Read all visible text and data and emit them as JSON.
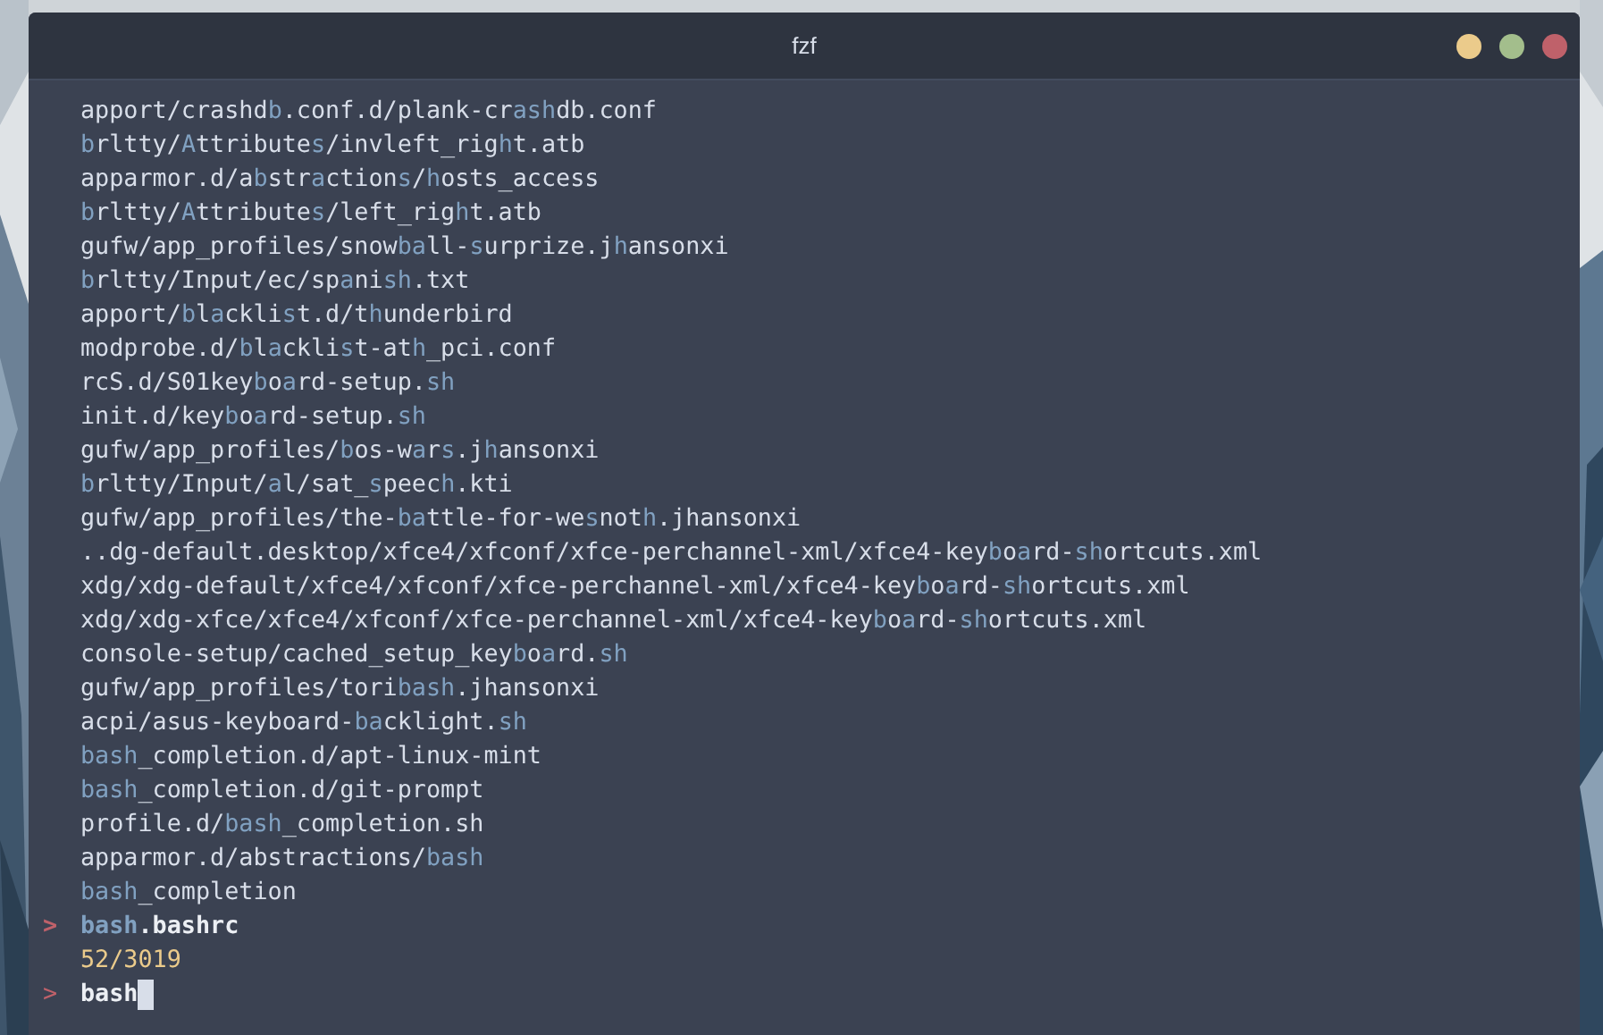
{
  "window": {
    "title": "fzf",
    "buttons": [
      {
        "color": "#ebcb8b"
      },
      {
        "color": "#a3be8c"
      },
      {
        "color": "#bf616a"
      }
    ]
  },
  "results": [
    {
      "segments": [
        {
          "text": "apport/crashd",
          "match": false
        },
        {
          "text": "b",
          "match": true
        },
        {
          "text": ".conf.d/plank-cr",
          "match": false
        },
        {
          "text": "ash",
          "match": true
        },
        {
          "text": "db.conf",
          "match": false
        }
      ]
    },
    {
      "segments": [
        {
          "text": "b",
          "match": true
        },
        {
          "text": "rltty/",
          "match": false
        },
        {
          "text": "A",
          "match": true
        },
        {
          "text": "ttribute",
          "match": false
        },
        {
          "text": "s",
          "match": true
        },
        {
          "text": "/invleft_rig",
          "match": false
        },
        {
          "text": "h",
          "match": true
        },
        {
          "text": "t.atb",
          "match": false
        }
      ]
    },
    {
      "segments": [
        {
          "text": "apparmor.d/a",
          "match": false
        },
        {
          "text": "b",
          "match": true
        },
        {
          "text": "str",
          "match": false
        },
        {
          "text": "a",
          "match": true
        },
        {
          "text": "ction",
          "match": false
        },
        {
          "text": "s",
          "match": true
        },
        {
          "text": "/",
          "match": false
        },
        {
          "text": "h",
          "match": true
        },
        {
          "text": "osts_access",
          "match": false
        }
      ]
    },
    {
      "segments": [
        {
          "text": "b",
          "match": true
        },
        {
          "text": "rltty/",
          "match": false
        },
        {
          "text": "A",
          "match": true
        },
        {
          "text": "ttribute",
          "match": false
        },
        {
          "text": "s",
          "match": true
        },
        {
          "text": "/left_rig",
          "match": false
        },
        {
          "text": "h",
          "match": true
        },
        {
          "text": "t.atb",
          "match": false
        }
      ]
    },
    {
      "segments": [
        {
          "text": "gufw/app_profiles/snow",
          "match": false
        },
        {
          "text": "ba",
          "match": true
        },
        {
          "text": "ll-",
          "match": false
        },
        {
          "text": "s",
          "match": true
        },
        {
          "text": "urprize.j",
          "match": false
        },
        {
          "text": "h",
          "match": true
        },
        {
          "text": "ansonxi",
          "match": false
        }
      ]
    },
    {
      "segments": [
        {
          "text": "b",
          "match": true
        },
        {
          "text": "rltty/Input/ec/sp",
          "match": false
        },
        {
          "text": "a",
          "match": true
        },
        {
          "text": "ni",
          "match": false
        },
        {
          "text": "sh",
          "match": true
        },
        {
          "text": ".txt",
          "match": false
        }
      ]
    },
    {
      "segments": [
        {
          "text": "apport/",
          "match": false
        },
        {
          "text": "b",
          "match": true
        },
        {
          "text": "l",
          "match": false
        },
        {
          "text": "a",
          "match": true
        },
        {
          "text": "ckli",
          "match": false
        },
        {
          "text": "s",
          "match": true
        },
        {
          "text": "t.d/t",
          "match": false
        },
        {
          "text": "h",
          "match": true
        },
        {
          "text": "underbird",
          "match": false
        }
      ]
    },
    {
      "segments": [
        {
          "text": "modprobe.d/",
          "match": false
        },
        {
          "text": "b",
          "match": true
        },
        {
          "text": "l",
          "match": false
        },
        {
          "text": "a",
          "match": true
        },
        {
          "text": "ckli",
          "match": false
        },
        {
          "text": "s",
          "match": true
        },
        {
          "text": "t-at",
          "match": false
        },
        {
          "text": "h",
          "match": true
        },
        {
          "text": "_pci.conf",
          "match": false
        }
      ]
    },
    {
      "segments": [
        {
          "text": "rcS.d/S01key",
          "match": false
        },
        {
          "text": "b",
          "match": true
        },
        {
          "text": "o",
          "match": false
        },
        {
          "text": "a",
          "match": true
        },
        {
          "text": "rd-setup.",
          "match": false
        },
        {
          "text": "sh",
          "match": true
        }
      ]
    },
    {
      "segments": [
        {
          "text": "init.d/key",
          "match": false
        },
        {
          "text": "b",
          "match": true
        },
        {
          "text": "o",
          "match": false
        },
        {
          "text": "a",
          "match": true
        },
        {
          "text": "rd-setup.",
          "match": false
        },
        {
          "text": "sh",
          "match": true
        }
      ]
    },
    {
      "segments": [
        {
          "text": "gufw/app_profiles/",
          "match": false
        },
        {
          "text": "b",
          "match": true
        },
        {
          "text": "os-w",
          "match": false
        },
        {
          "text": "a",
          "match": true
        },
        {
          "text": "r",
          "match": false
        },
        {
          "text": "s",
          "match": true
        },
        {
          "text": ".j",
          "match": false
        },
        {
          "text": "h",
          "match": true
        },
        {
          "text": "ansonxi",
          "match": false
        }
      ]
    },
    {
      "segments": [
        {
          "text": "b",
          "match": true
        },
        {
          "text": "rltty/Input/",
          "match": false
        },
        {
          "text": "a",
          "match": true
        },
        {
          "text": "l/sat_",
          "match": false
        },
        {
          "text": "s",
          "match": true
        },
        {
          "text": "peec",
          "match": false
        },
        {
          "text": "h",
          "match": true
        },
        {
          "text": ".kti",
          "match": false
        }
      ]
    },
    {
      "segments": [
        {
          "text": "gufw/app_profiles/the-",
          "match": false
        },
        {
          "text": "ba",
          "match": true
        },
        {
          "text": "ttle-for-we",
          "match": false
        },
        {
          "text": "s",
          "match": true
        },
        {
          "text": "not",
          "match": false
        },
        {
          "text": "h",
          "match": true
        },
        {
          "text": ".jhansonxi",
          "match": false
        }
      ]
    },
    {
      "segments": [
        {
          "text": "..dg-default.desktop/xfce4/xfconf/xfce-perchannel-xml/xfce4-key",
          "match": false
        },
        {
          "text": "b",
          "match": true
        },
        {
          "text": "o",
          "match": false
        },
        {
          "text": "a",
          "match": true
        },
        {
          "text": "rd-",
          "match": false
        },
        {
          "text": "sh",
          "match": true
        },
        {
          "text": "ortcuts.xml",
          "match": false
        }
      ]
    },
    {
      "segments": [
        {
          "text": "xdg/xdg-default/xfce4/xfconf/xfce-perchannel-xml/xfce4-key",
          "match": false
        },
        {
          "text": "b",
          "match": true
        },
        {
          "text": "o",
          "match": false
        },
        {
          "text": "a",
          "match": true
        },
        {
          "text": "rd-",
          "match": false
        },
        {
          "text": "sh",
          "match": true
        },
        {
          "text": "ortcuts.xml",
          "match": false
        }
      ]
    },
    {
      "segments": [
        {
          "text": "xdg/xdg-xfce/xfce4/xfconf/xfce-perchannel-xml/xfce4-key",
          "match": false
        },
        {
          "text": "b",
          "match": true
        },
        {
          "text": "o",
          "match": false
        },
        {
          "text": "a",
          "match": true
        },
        {
          "text": "rd-",
          "match": false
        },
        {
          "text": "sh",
          "match": true
        },
        {
          "text": "ortcuts.xml",
          "match": false
        }
      ]
    },
    {
      "segments": [
        {
          "text": "console-setup/cached_setup_key",
          "match": false
        },
        {
          "text": "b",
          "match": true
        },
        {
          "text": "o",
          "match": false
        },
        {
          "text": "a",
          "match": true
        },
        {
          "text": "rd.",
          "match": false
        },
        {
          "text": "sh",
          "match": true
        }
      ]
    },
    {
      "segments": [
        {
          "text": "gufw/app_profiles/tori",
          "match": false
        },
        {
          "text": "bash",
          "match": true
        },
        {
          "text": ".jhansonxi",
          "match": false
        }
      ]
    },
    {
      "segments": [
        {
          "text": "acpi/asus-keyboard-",
          "match": false
        },
        {
          "text": "ba",
          "match": true
        },
        {
          "text": "cklight.",
          "match": false
        },
        {
          "text": "sh",
          "match": true
        }
      ]
    },
    {
      "segments": [
        {
          "text": "bash",
          "match": true
        },
        {
          "text": "_completion.d/apt-linux-mint",
          "match": false
        }
      ]
    },
    {
      "segments": [
        {
          "text": "bash",
          "match": true
        },
        {
          "text": "_completion.d/git-prompt",
          "match": false
        }
      ]
    },
    {
      "segments": [
        {
          "text": "profile.d/",
          "match": false
        },
        {
          "text": "bash",
          "match": true
        },
        {
          "text": "_completion.sh",
          "match": false
        }
      ]
    },
    {
      "segments": [
        {
          "text": "apparmor.d/abstractions/",
          "match": false
        },
        {
          "text": "bash",
          "match": true
        }
      ]
    },
    {
      "segments": [
        {
          "text": "bash",
          "match": true
        },
        {
          "text": "_completion",
          "match": false
        }
      ]
    }
  ],
  "selected_result": {
    "pointer": ">",
    "segments": [
      {
        "text": "bash",
        "match": true
      },
      {
        "text": ".bashrc",
        "match": false
      }
    ]
  },
  "count": "52/3019",
  "prompt": {
    "symbol": ">",
    "query": "bash"
  }
}
